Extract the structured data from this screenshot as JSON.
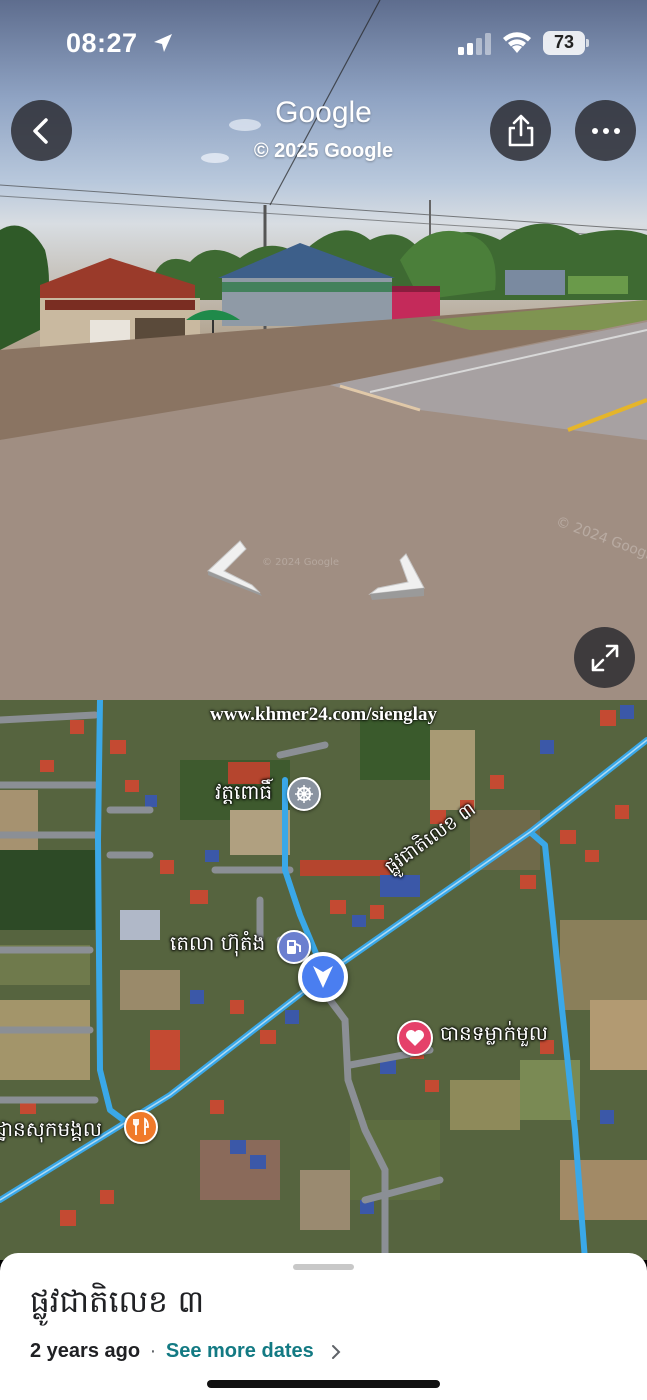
{
  "status_bar": {
    "time": "08:27",
    "battery": "73",
    "icons": [
      "location-arrow-icon",
      "cellular-signal-icon",
      "wifi-icon",
      "battery-icon"
    ]
  },
  "street_view": {
    "title": "Google",
    "copyright": "© 2025 Google",
    "buttons": [
      "back-icon",
      "share-icon",
      "more-icon",
      "expand-icon"
    ],
    "nav_arrows": [
      "nav-arrow-left",
      "nav-arrow-right"
    ]
  },
  "map": {
    "watermark": "www.khmer24.com/sienglay",
    "labels": {
      "pagoda": "វត្តពោធិ៍",
      "gas_station": "តេលា ហ៊ុតំង",
      "love_shop": "បានទម្លាក់មួល",
      "restaurant": "ដ្ឋានសុកមង្គល",
      "road": "ផ្លូវជាតិលេខ ៣"
    },
    "pin_icons": [
      "pagoda-icon",
      "gas-station-icon",
      "heart-icon",
      "restaurant-icon"
    ]
  },
  "sheet": {
    "title": "ផ្លូវជាតិលេខ ៣",
    "date": "2 years ago",
    "separator": "·",
    "see_more": "See more dates"
  },
  "colors": {
    "accent_link": "#137a83",
    "road_blue": "#3aa8e8",
    "you_marker": "#4a7ef0"
  }
}
